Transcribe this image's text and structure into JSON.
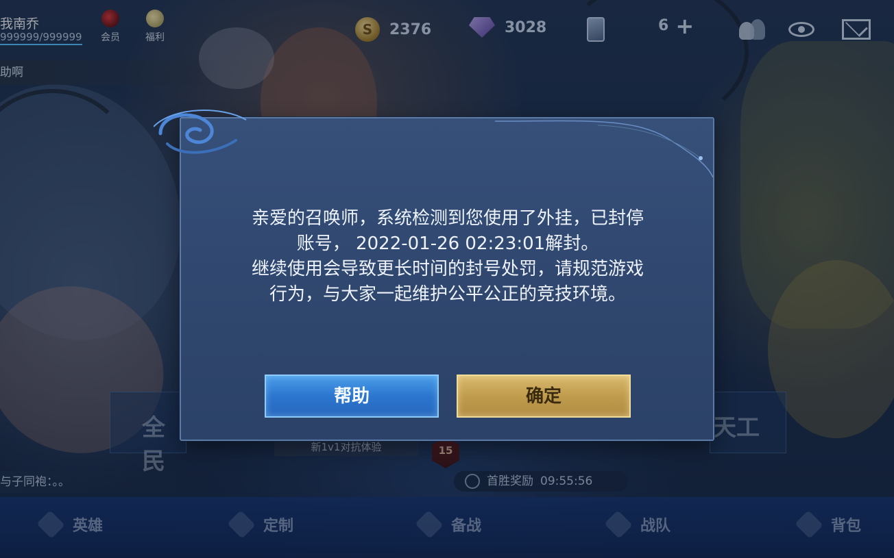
{
  "player": {
    "name": "我南乔",
    "exp": "999999/999999"
  },
  "top_icons": {
    "vip": "会员",
    "perk": "福利"
  },
  "currency": {
    "coins": "2376",
    "gems": "3028",
    "tickets": "6"
  },
  "chat_top": "助啊",
  "modes": {
    "left_title": "全民",
    "right_title": "天工",
    "sub_mode": "新1v1对抗体验",
    "rank": "15"
  },
  "chat_bottom": "与子同袍：。。",
  "first_win": {
    "label": "首胜奖励",
    "timer": "09:55:56"
  },
  "nav": [
    {
      "label": "英雄"
    },
    {
      "label": "定制"
    },
    {
      "label": "备战"
    },
    {
      "label": "战队"
    },
    {
      "label": "背包"
    }
  ],
  "dialog": {
    "line1": "亲爱的召唤师，系统检测到您使用了外挂，已封停",
    "line2": "账号， 2022-01-26 02:23:01解封。",
    "line3": "继续使用会导致更长时间的封号处罚，请规范游戏",
    "line4": "行为，与大家一起维护公平公正的竞技环境。",
    "help_label": "帮助",
    "confirm_label": "确定"
  },
  "colors": {
    "dialog_bg": "#36507a",
    "help_button": "#2c76cf",
    "confirm_button": "#c09c4e"
  }
}
